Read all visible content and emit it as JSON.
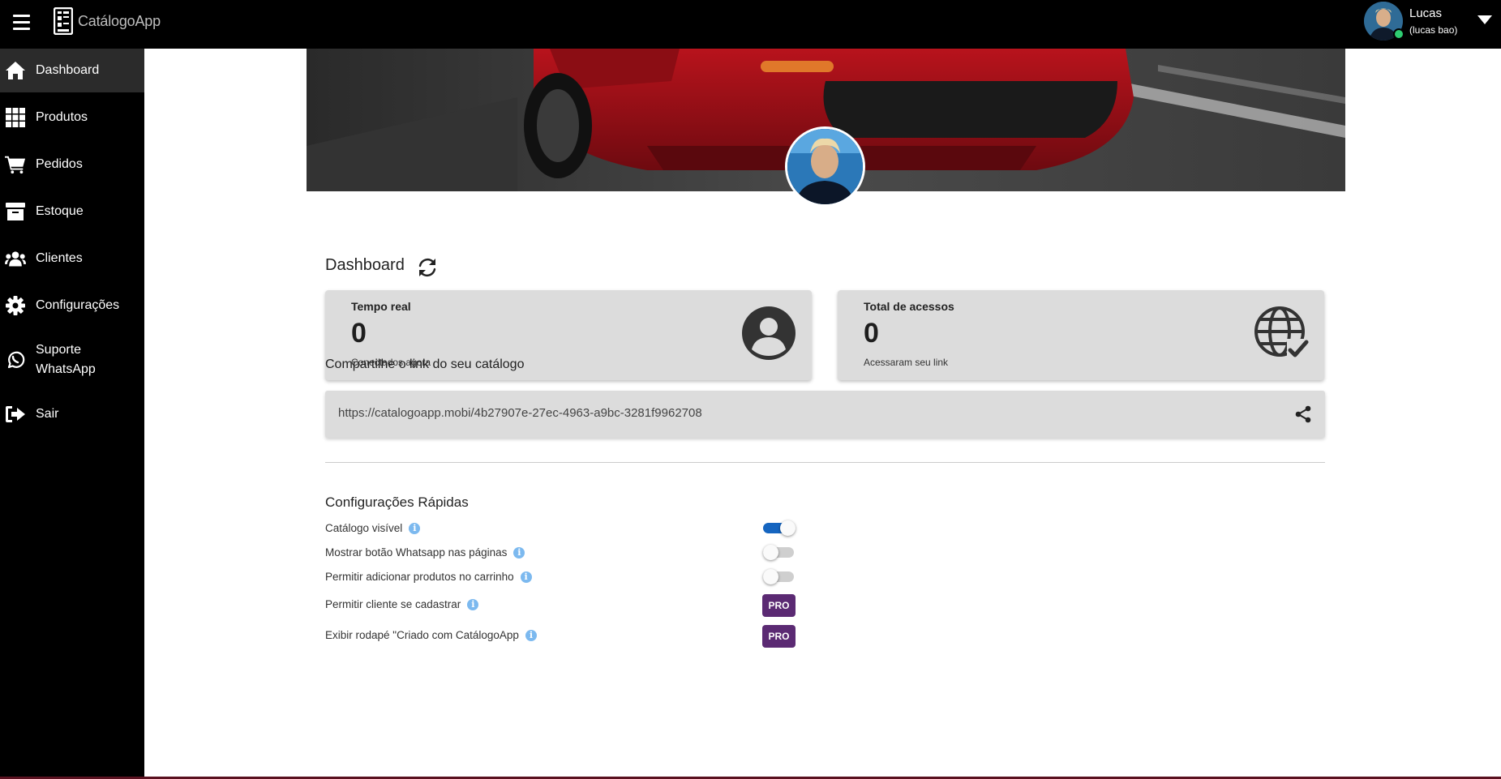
{
  "app": {
    "name": "CatálogoApp"
  },
  "user": {
    "name": "Lucas",
    "handle": "(lucas bao)",
    "status_color": "#2ecc71"
  },
  "sidebar": {
    "items": [
      {
        "label": "Dashboard",
        "icon": "home-icon",
        "active": true
      },
      {
        "label": "Produtos",
        "icon": "grid-icon"
      },
      {
        "label": "Pedidos",
        "icon": "cart-icon"
      },
      {
        "label": "Estoque",
        "icon": "archive-icon"
      },
      {
        "label": "Clientes",
        "icon": "users-icon"
      },
      {
        "label": "Configurações",
        "icon": "gear-icon"
      },
      {
        "label": "Suporte\nWhatsApp",
        "line1": "Suporte",
        "line2": "WhatsApp",
        "icon": "whatsapp-icon"
      },
      {
        "label": "Sair",
        "icon": "sign-out-icon"
      }
    ]
  },
  "dashboard": {
    "title": "Dashboard",
    "cards": [
      {
        "title": "Tempo real",
        "value": "0",
        "subtitle": "Conectados agora",
        "icon": "user-circle-icon"
      },
      {
        "title": "Total de acessos",
        "value": "0",
        "subtitle": "Acessaram seu link",
        "icon": "globe-check-icon"
      }
    ]
  },
  "share": {
    "label": "Compartilhe o link do seu catálogo",
    "url": "https://catalogoapp.mobi/4b27907e-27ec-4963-a9bc-3281f9962708"
  },
  "quick_settings": {
    "title": "Configurações Rápidas",
    "items": [
      {
        "label": "Catálogo visível",
        "control": "toggle",
        "on": true
      },
      {
        "label": "Mostrar botão Whatsapp nas páginas",
        "control": "toggle",
        "on": false
      },
      {
        "label": "Permitir adicionar produtos no carrinho",
        "control": "toggle",
        "on": false
      },
      {
        "label": "Permitir cliente se cadastrar",
        "control": "pro",
        "badge": "PRO"
      },
      {
        "label": "Exibir rodapé \"Criado com CatálogoApp",
        "control": "pro",
        "badge": "PRO"
      }
    ],
    "info_glyph": "i"
  },
  "colors": {
    "topbar": "#000000",
    "sidebar": "#000000",
    "sidebar_active": "#2b2b2b",
    "card_bg": "#dcdcdc",
    "toggle_on": "#1565c0",
    "pro_badge": "#5b2a73",
    "info_icon": "#7cb9ef"
  }
}
